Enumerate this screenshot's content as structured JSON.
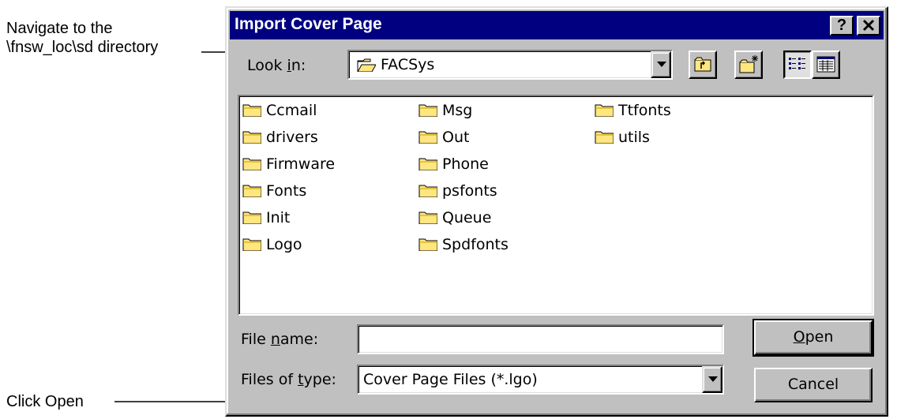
{
  "callouts": {
    "navigate_line1": "Navigate to the",
    "navigate_line2": "\\fnsw_loc\\sd directory",
    "click_open": "Click Open"
  },
  "dialog": {
    "title": "Import Cover Page",
    "help_glyph": "?",
    "close_glyph": "✕",
    "look_in_label_pre": "Look ",
    "look_in_label_ul": "i",
    "look_in_label_post": "n:",
    "look_in_value": "FACSys",
    "toolbar_icons": [
      "up-one-level-icon",
      "create-new-folder-icon",
      "list-view-icon",
      "details-view-icon"
    ],
    "folders": {
      "col1": [
        "Ccmail",
        "drivers",
        "Firmware",
        "Fonts",
        "Init",
        "Logo"
      ],
      "col2": [
        "Msg",
        "Out",
        "Phone",
        "psfonts",
        "Queue",
        "Spdfonts"
      ],
      "col3": [
        "Ttfonts",
        "utils"
      ]
    },
    "file_name_label_pre": "File ",
    "file_name_label_ul": "n",
    "file_name_label_post": "ame:",
    "file_name_value": "",
    "files_of_type_label_pre": "Files of ",
    "files_of_type_label_ul": "t",
    "files_of_type_label_post": "ype:",
    "files_of_type_value": "Cover Page Files (*.lgo)",
    "open_label_ul": "O",
    "open_label_post": "pen",
    "cancel_label": "Cancel"
  },
  "colors": {
    "titlebar": "#000080",
    "face": "#c0c0c0",
    "folder": "#ffe680"
  }
}
